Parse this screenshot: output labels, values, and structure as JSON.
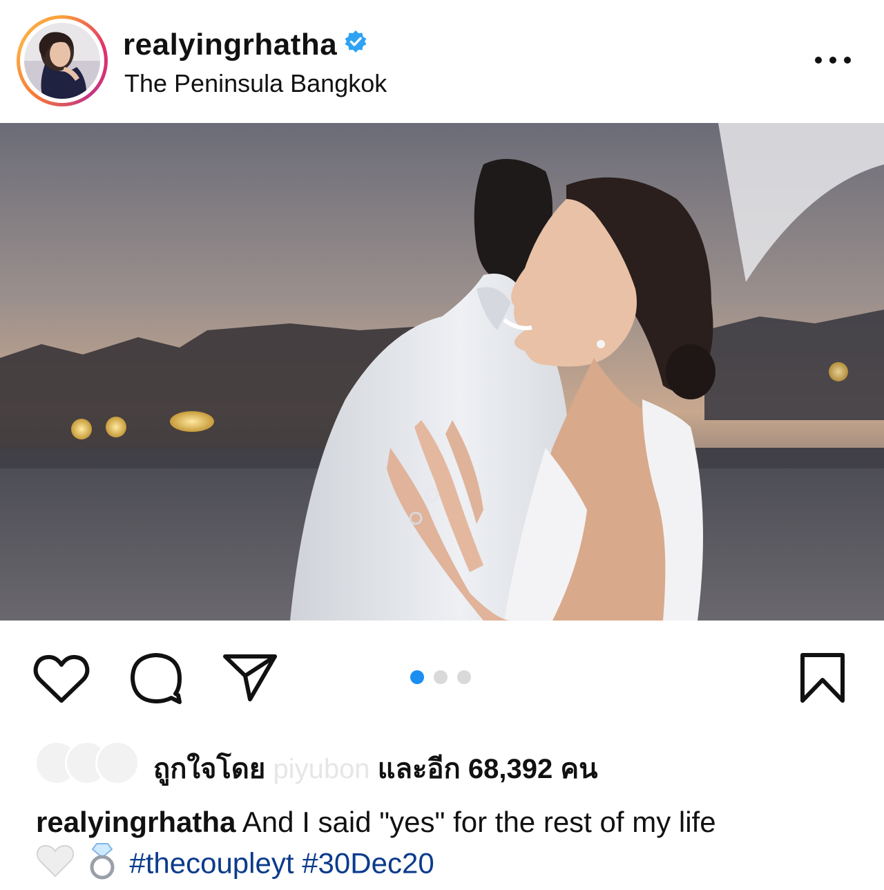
{
  "post": {
    "username": "realyingrhatha",
    "location": "The Peninsula Bangkok",
    "verified_icon": "verified-badge-icon",
    "more_icon": "more-options-icon"
  },
  "actions": {
    "like_icon": "heart-icon",
    "comment_icon": "comment-icon",
    "share_icon": "share-icon",
    "save_icon": "bookmark-icon",
    "carousel": {
      "total": 3,
      "active_index": 0,
      "active_color": "#1b8ef2"
    }
  },
  "likes": {
    "prefix": "ถูกใจโดย",
    "liker": "piyubon",
    "and_more": "และอีก",
    "count": "68,392",
    "suffix": "คน"
  },
  "caption": {
    "username": "realyingrhatha",
    "text": "And I said \"yes\" for the rest of my life",
    "emojis": [
      "white-heart-icon",
      "ring-icon"
    ],
    "hashtags": [
      "#thecoupleyt",
      "#30Dec20"
    ]
  }
}
